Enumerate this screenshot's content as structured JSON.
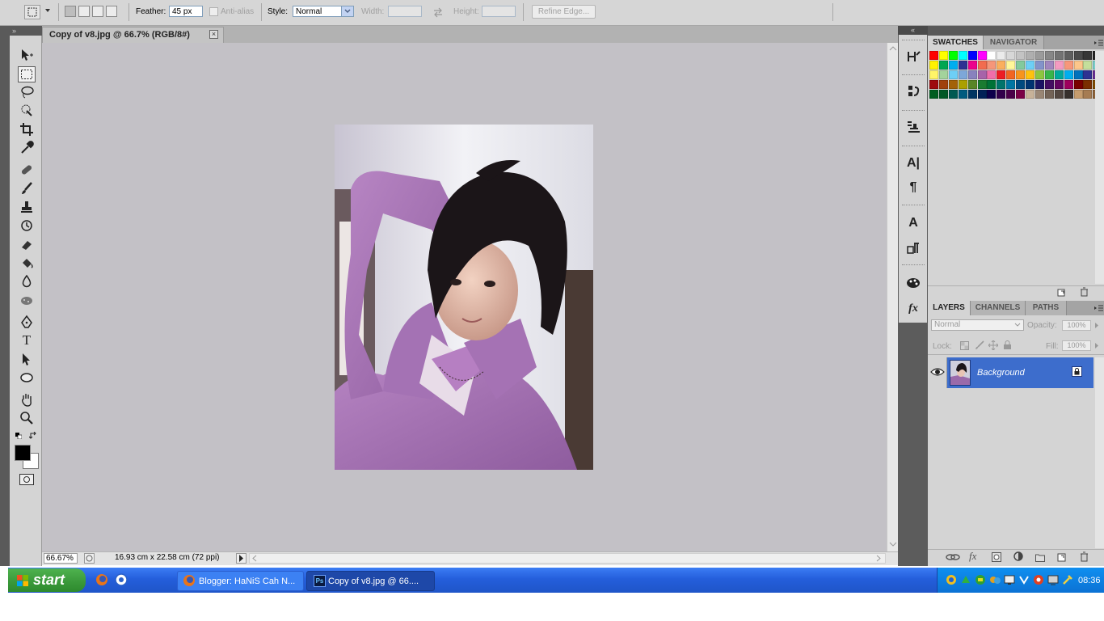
{
  "options_bar": {
    "feather_label": "Feather:",
    "feather_value": "45 px",
    "anti_alias_label": "Anti-alias",
    "style_label": "Style:",
    "style_value": "Normal",
    "width_label": "Width:",
    "height_label": "Height:",
    "refine_edge_label": "Refine Edge..."
  },
  "document": {
    "tab_title": "Copy of v8.jpg @ 66.7% (RGB/8#)",
    "close_glyph": "×",
    "zoom": "66.67%",
    "doc_size": "16.93 cm x 22.58 cm (72 ppi)"
  },
  "swatches_panel": {
    "tabs": [
      "SWATCHES",
      "NAVIGATOR"
    ],
    "active_tab": "SWATCHES",
    "colors": [
      "#ff0000",
      "#ffff00",
      "#00ff00",
      "#00ffff",
      "#0000ff",
      "#ff00ff",
      "#ffffff",
      "#ebebeb",
      "#d7d7d7",
      "#c3c3c3",
      "#afafaf",
      "#9b9b9b",
      "#878787",
      "#737373",
      "#5f5f5f",
      "#4b4b4b",
      "#373737",
      "#232323",
      "#000000",
      "#ee1d24",
      "#fff200",
      "#00a651",
      "#00aeef",
      "#2e3192",
      "#ec008c",
      "#f26c4f",
      "#f69679",
      "#fbaf5d",
      "#fff799",
      "#82ca9c",
      "#6dcff6",
      "#8393ca",
      "#a186be",
      "#f49ac1",
      "#f7977a",
      "#fdc68a",
      "#c4df9b",
      "#7accc8",
      "#7ea7d8",
      "#bd8cbf",
      "#fff568",
      "#a3d39c",
      "#6ecff6",
      "#7da7d9",
      "#8882be",
      "#a763a9",
      "#f06eaa",
      "#ed1c24",
      "#f26522",
      "#f7941d",
      "#ffc20e",
      "#8dc63f",
      "#39b54a",
      "#00a99d",
      "#00aeef",
      "#0072bc",
      "#2e3192",
      "#662d91",
      "#92278f",
      "#ec008c",
      "#9e0b0f",
      "#a0410d",
      "#a36209",
      "#aba000",
      "#598527",
      "#197b30",
      "#007236",
      "#00746b",
      "#0076a3",
      "#004a80",
      "#003471",
      "#1b1464",
      "#440e62",
      "#630460",
      "#9e005d",
      "#790000",
      "#7b2e00",
      "#7d4900",
      "#827b00",
      "#406618",
      "#005e20",
      "#005826",
      "#005952",
      "#005b7f",
      "#003663",
      "#002157",
      "#0d004c",
      "#32004b",
      "#4b0049",
      "#7b0046",
      "#c7b299",
      "#998675",
      "#736357",
      "#534741",
      "#37302d",
      "#c69c6d",
      "#a67c52",
      "#8c6239",
      "#754c24",
      "#603813"
    ]
  },
  "layers_panel": {
    "tabs": [
      "LAYERS",
      "CHANNELS",
      "PATHS"
    ],
    "active_tab": "LAYERS",
    "blend_mode": "Normal",
    "opacity_label": "Opacity:",
    "opacity_value": "100%",
    "lock_label": "Lock:",
    "fill_label": "Fill:",
    "fill_value": "100%",
    "layer_name": "Background"
  },
  "dock": {
    "char_glyph": "A|",
    "para_glyph": "¶",
    "char_style_glyph": "A",
    "fx_glyph": "fx"
  },
  "taskbar": {
    "start_label": "start",
    "tasks": [
      "Blogger: HaNiS Cah N...",
      "Copy of v8.jpg @ 66...."
    ],
    "clock": "08:36"
  },
  "colors": {
    "canvas_bg": "#c3c1c6",
    "panel_bg": "#d4d4d4",
    "layer_selected": "#3d6dcc",
    "taskbar_blue": "#245edb",
    "start_green": "#3b9a3b"
  }
}
